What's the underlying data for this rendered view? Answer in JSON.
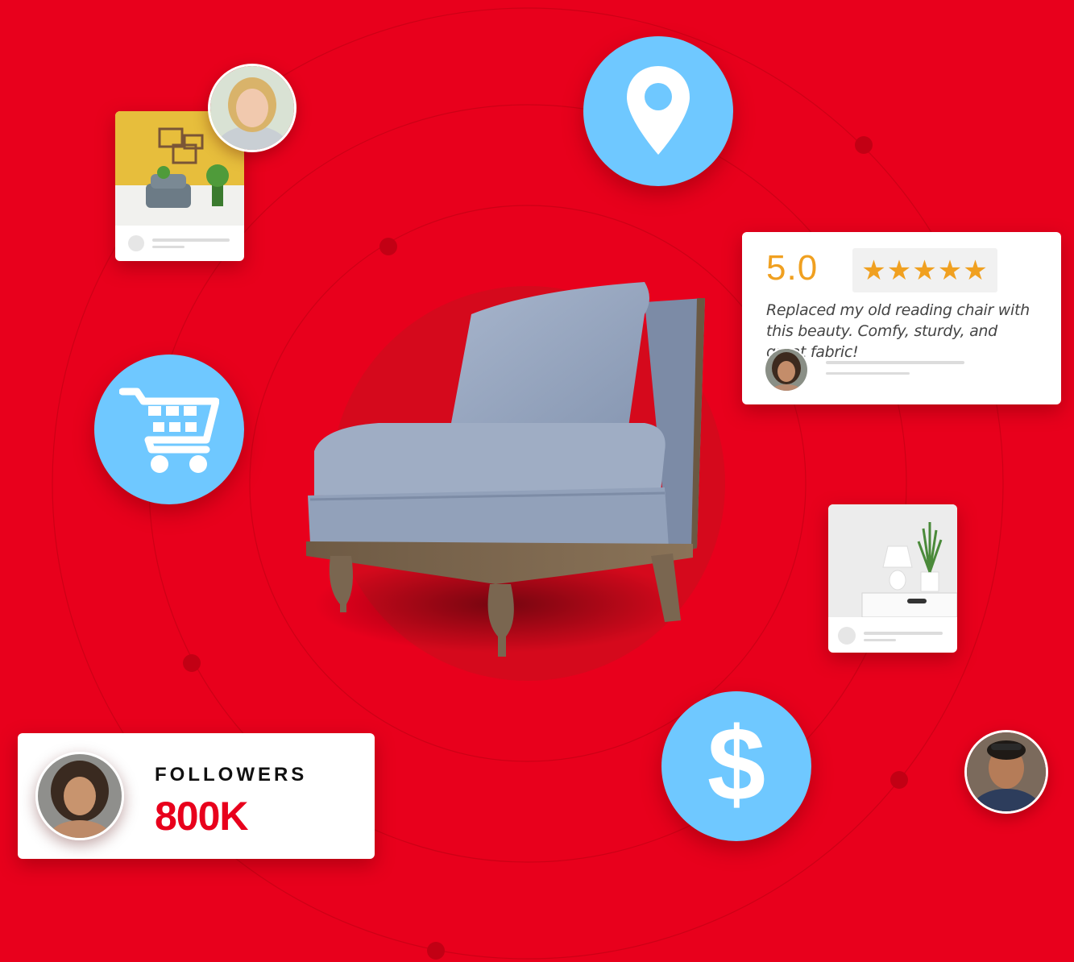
{
  "colors": {
    "background": "#e8001c",
    "icon_circle": "#6fc8ff",
    "star": "#f0a020",
    "accent_red": "#e8001c"
  },
  "icons": {
    "location": "location-pin-icon",
    "cart": "shopping-cart-icon",
    "dollar": "dollar-sign-icon"
  },
  "review": {
    "score": "5.0",
    "stars": "★★★★★",
    "rating": 5,
    "text": "Replaced my old reading chair with this beauty. Comfy, sturdy, and great fabric!"
  },
  "followers": {
    "label": "FOLLOWERS",
    "count": "800K"
  },
  "dollar_symbol": "$"
}
